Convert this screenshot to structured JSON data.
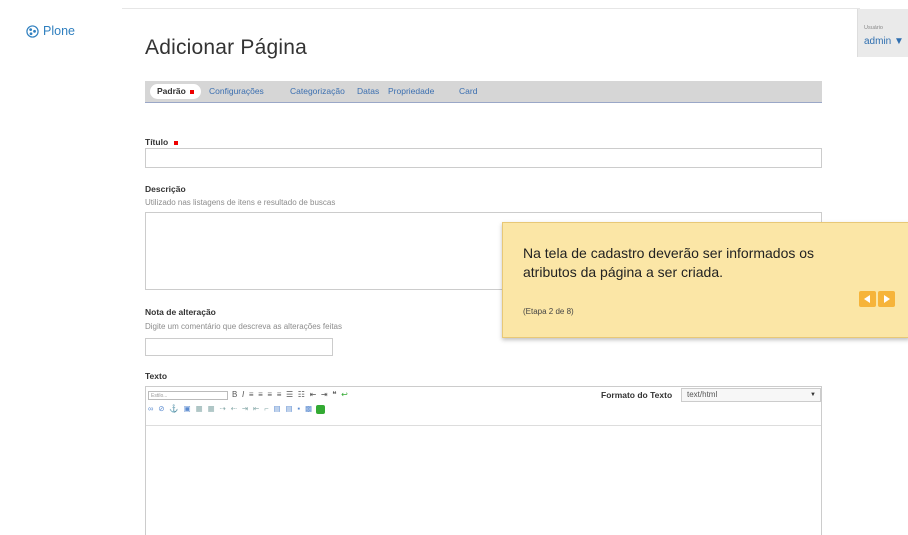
{
  "logo": {
    "text": "Plone"
  },
  "user": {
    "label": "Usuário",
    "name": "admin ▼"
  },
  "page": {
    "title": "Adicionar Página"
  },
  "tabs": [
    {
      "label": "Padrão",
      "required": true,
      "active": true
    },
    {
      "label": "Configurações"
    },
    {
      "label": "Categorização"
    },
    {
      "label": "Datas"
    },
    {
      "label": "Propriedade"
    },
    {
      "label": "Card"
    }
  ],
  "fields": {
    "titulo": {
      "label": "Título",
      "required": true,
      "value": ""
    },
    "descricao": {
      "label": "Descrição",
      "help": "Utilizado nas listagens de itens e resultado de buscas",
      "value": ""
    },
    "nota": {
      "label": "Nota de alteração",
      "help": "Digite um comentário que descreva as alterações feitas",
      "value": ""
    },
    "texto": {
      "label": "Texto",
      "style_placeholder": "Estilo...",
      "format_label": "Formato do Texto",
      "format_value": "text/html"
    }
  },
  "tooltip": {
    "text": "Na tela de cadastro deverão ser informados os atributos da página a ser criada.",
    "step": "(Etapa 2 de 8)"
  },
  "colors": {
    "accent": "#3b6fb0",
    "tooltip_bg": "#fbe6a6",
    "nav_button": "#f6b43a",
    "required": "#ee0000"
  }
}
